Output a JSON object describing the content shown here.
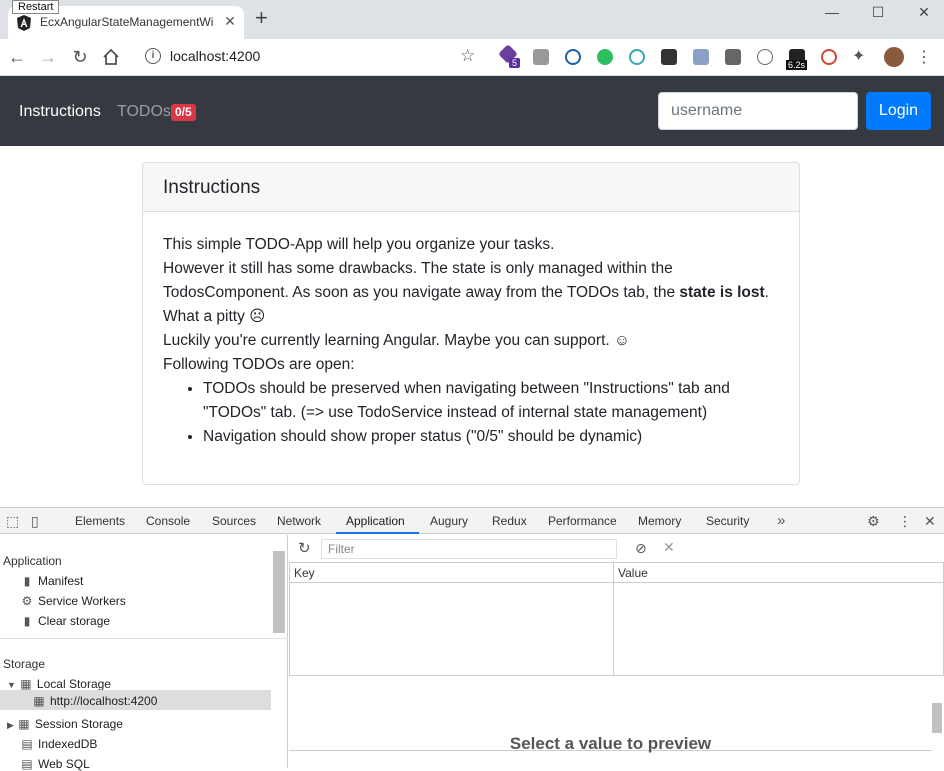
{
  "browser": {
    "tooltip": "Restart",
    "tab_title": "EcxAngularStateManagementWi",
    "url": "localhost:4200",
    "extension_badge": "5",
    "extension_timer": "6.2s",
    "icons": {
      "back": "arrow-left-icon",
      "forward": "arrow-right-icon",
      "reload": "reload-icon",
      "home": "home-icon",
      "bookmark": "star-icon"
    }
  },
  "app": {
    "nav": {
      "instructions_label": "Instructions",
      "todos_label": "TODOs",
      "todos_badge": "0/5",
      "badge_color": "#dc3545"
    },
    "login": {
      "username_placeholder": "username",
      "login_label": "Login",
      "button_color": "#007bff"
    },
    "card": {
      "title": "Instructions",
      "line1": "This simple TODO-App will help you organize your tasks.",
      "line2_start": "However it still has some drawbacks. The state is only managed within the TodosComponent. As soon as you navigate away from the TODOs tab, the ",
      "line2_bold": "state is lost",
      "line2_end": ".",
      "line3": "What a pitty ☹",
      "line4": "Luckily you're currently learning Angular. Maybe you can support. ☺",
      "line5": "Following TODOs are open:",
      "todos": [
        "TODOs should be preserved when navigating between \"Instructions\" tab and \"TODOs\" tab. (=> use TodoService instead of internal state management)",
        "Navigation should show proper status (\"0/5\" should be dynamic)"
      ]
    }
  },
  "devtools": {
    "tabs": [
      "Elements",
      "Console",
      "Sources",
      "Network",
      "Application",
      "Augury",
      "Redux",
      "Performance",
      "Memory",
      "Security"
    ],
    "active_tab": "Application",
    "sidebar": {
      "application_header": "Application",
      "application_items": [
        "Manifest",
        "Service Workers",
        "Clear storage"
      ],
      "storage_header": "Storage",
      "local_storage": "Local Storage",
      "local_storage_child": "http://localhost:4200",
      "session_storage": "Session Storage",
      "indexeddb": "IndexedDB",
      "websql": "Web SQL"
    },
    "filter_placeholder": "Filter",
    "columns": [
      "Key",
      "Value"
    ],
    "preview_text": "Select a value to preview"
  }
}
